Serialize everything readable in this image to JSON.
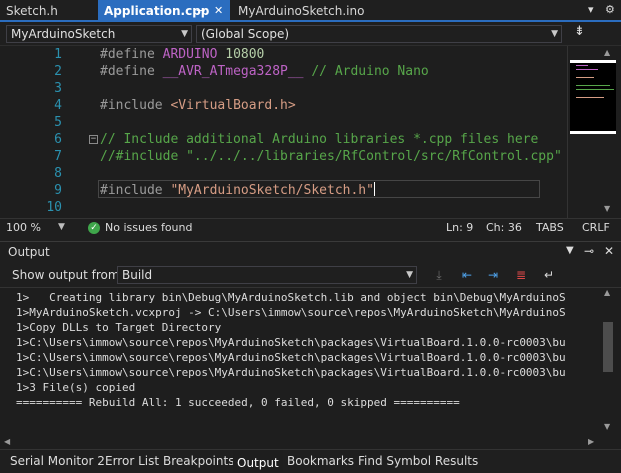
{
  "colors": {
    "accent": "#2b6dbf",
    "success": "#3fa64b",
    "comment": "#57a64a",
    "macro": "#bd63c5",
    "string": "#d69d85",
    "number": "#b5cea8",
    "line_number": "#2b91af"
  },
  "doc_tabs": [
    {
      "label": "Sketch.h",
      "active": false
    },
    {
      "label": "Application.cpp",
      "active": true,
      "icons": [
        "pin-icon",
        "close-icon"
      ]
    },
    {
      "label": "MyArduinoSketch.ino",
      "active": false
    }
  ],
  "strip_controls": {
    "overflow_icon": "chevron-down-icon",
    "settings_icon": "gear-icon"
  },
  "nav": {
    "project": "MyArduinoSketch",
    "scope": "(Global Scope)",
    "split_icon": "split-editor-icon"
  },
  "code": {
    "line_numbers": [
      "1",
      "2",
      "3",
      "4",
      "5",
      "6",
      "7",
      "8",
      "9",
      "10"
    ],
    "l1_directive": "#define",
    "l1_macro": "ARDUINO",
    "l1_value": "10800",
    "l2_directive": "#define",
    "l2_macro": "__AVR_ATmega328P__",
    "l2_comment": "// Arduino Nano",
    "l4_directive": "#include",
    "l4_header": "<VirtualBoard.h>",
    "l6_comment": "// Include additional Arduino libraries *.cpp files here",
    "l7_comment": "//#include \"../../../libraries/RfControl/src/RfControl.cpp\"",
    "l9_directive": "#include",
    "l9_header": "\"MyArduinoSketch/Sketch.h\"",
    "fold_glyph": "−"
  },
  "editor_status": {
    "zoom": "100 %",
    "issues": "No issues found",
    "line": "Ln: 9",
    "col": "Ch: 36",
    "indent": "TABS",
    "eol": "CRLF"
  },
  "output": {
    "title": "Output",
    "show_from_label": "Show output from:",
    "source": "Build",
    "lines": [
      "1>   Creating library bin\\Debug\\MyArduinoSketch.lib and object bin\\Debug\\MyArduinoS",
      "1>MyArduinoSketch.vcxproj -> C:\\Users\\immow\\source\\repos\\MyArduinoSketch\\MyArduinoS",
      "1>Copy DLLs to Target Directory",
      "1>C:\\Users\\immow\\source\\repos\\MyArduinoSketch\\packages\\VirtualBoard.1.0.0-rc0003\\bu",
      "1>C:\\Users\\immow\\source\\repos\\MyArduinoSketch\\packages\\VirtualBoard.1.0.0-rc0003\\bu",
      "1>C:\\Users\\immow\\source\\repos\\MyArduinoSketch\\packages\\VirtualBoard.1.0.0-rc0003\\bu",
      "1>3 File(s) copied",
      "========== Rebuild All: 1 succeeded, 0 failed, 0 skipped =========="
    ]
  },
  "bottom_tabs": [
    {
      "label": "Serial Monitor 2",
      "active": false
    },
    {
      "label": "Error List",
      "active": false
    },
    {
      "label": "Breakpoints",
      "active": false
    },
    {
      "label": "Output",
      "active": true
    },
    {
      "label": "Bookmarks",
      "active": false
    },
    {
      "label": "Find Symbol Results",
      "active": false
    }
  ]
}
